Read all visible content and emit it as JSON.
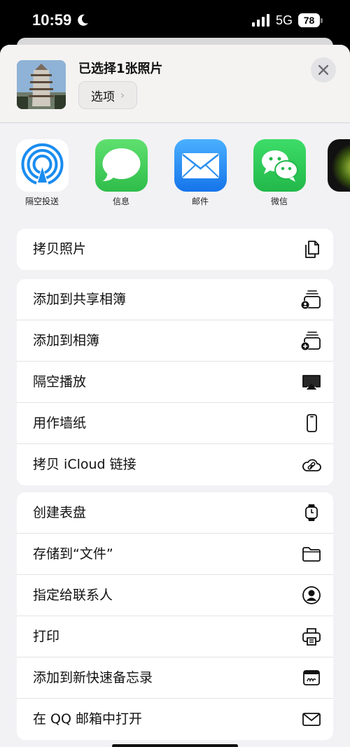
{
  "status_bar": {
    "time": "10:59",
    "network": "5G",
    "battery": "78"
  },
  "header": {
    "title": "已选择1张照片",
    "options_label": "选项",
    "options_chevron": "›"
  },
  "apps": [
    {
      "label": "隔空投送",
      "icon": "airdrop-icon"
    },
    {
      "label": "信息",
      "icon": "messages-icon"
    },
    {
      "label": "邮件",
      "icon": "mail-icon"
    },
    {
      "label": "微信",
      "icon": "wechat-icon"
    }
  ],
  "group1": [
    {
      "label": "拷贝照片",
      "icon": "copy-icon"
    }
  ],
  "group2": [
    {
      "label": "添加到共享相簿",
      "icon": "shared-album-icon"
    },
    {
      "label": "添加到相簿",
      "icon": "add-album-icon"
    },
    {
      "label": "隔空播放",
      "icon": "airplay-icon"
    },
    {
      "label": "用作墙纸",
      "icon": "phone-icon"
    },
    {
      "label": "拷贝 iCloud 链接",
      "icon": "icloud-link-icon"
    }
  ],
  "group3": [
    {
      "label": "创建表盘",
      "icon": "watch-icon"
    },
    {
      "label": "存储到“文件”",
      "icon": "folder-icon"
    },
    {
      "label": "指定给联系人",
      "icon": "contact-icon"
    },
    {
      "label": "打印",
      "icon": "printer-icon"
    },
    {
      "label": "添加到新快速备忘录",
      "icon": "quick-note-icon"
    },
    {
      "label": "在 QQ 邮箱中打开",
      "icon": "envelope-icon"
    }
  ],
  "colors": {
    "sheet_bg": "#f2f2f5",
    "messages_green": "#34c759",
    "mail_blue": "#1e8cf0",
    "wechat_green": "#2dc653"
  }
}
